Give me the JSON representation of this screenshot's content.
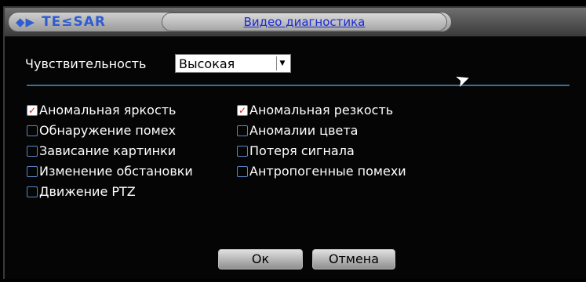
{
  "window": {
    "logo_icon": "◆▶",
    "logo_text": "TE≤SAR",
    "title": "Видео диагностика"
  },
  "sensitivity": {
    "label": "Чувствительность",
    "value": "Высокая"
  },
  "options": [
    {
      "label": "Аномальная яркость",
      "checked": true
    },
    {
      "label": "Аномальная резкость",
      "checked": true
    },
    {
      "label": "Обнаружение помех",
      "checked": false
    },
    {
      "label": "Аномалии цвета",
      "checked": false
    },
    {
      "label": "Зависание картинки",
      "checked": false
    },
    {
      "label": "Потеря сигнала",
      "checked": false
    },
    {
      "label": "Изменение обстановки",
      "checked": false
    },
    {
      "label": "Антропогенные помехи",
      "checked": false
    },
    {
      "label": "Движение PTZ",
      "checked": false
    }
  ],
  "buttons": {
    "ok": "Ок",
    "cancel": "Отмена"
  },
  "colors": {
    "title_text": "#1a2bd6",
    "check_mark": "#d8221b",
    "divider": "#3b6f98"
  }
}
